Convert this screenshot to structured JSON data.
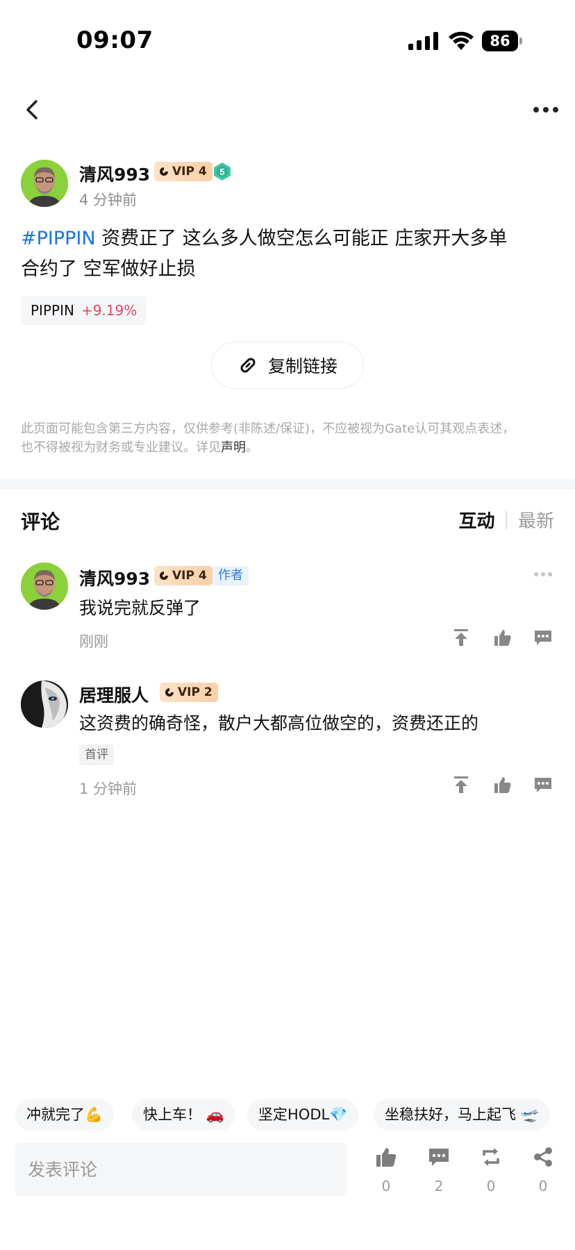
{
  "status_bar": {
    "time": "09:07",
    "battery": "86"
  },
  "post": {
    "author": "清风993",
    "vip": "VIP 4",
    "level": "5",
    "time": "4 分钟前",
    "hashtag": "#PIPPIN",
    "body_line1": " 资费正了  这么多人做空怎么可能正  庄家开大多单",
    "body_line2": "合约了  空军做好止损",
    "ticker": {
      "name": "PIPPIN",
      "change": "+9.19%"
    },
    "copy_link": "复制链接",
    "disclaimer_line1": "此页面可能包含第三方内容，仅供参考(非陈述/保证)，不应被视为Gate认可其观点表述，",
    "disclaimer_line2_prefix": "也不得被视为财务或专业建议。详见",
    "disclaimer_link": "声明",
    "disclaimer_suffix": "。"
  },
  "comments_section": {
    "title": "评论",
    "tabs": [
      "互动",
      "最新"
    ],
    "comments": [
      {
        "author": "清风993",
        "vip": "VIP 4",
        "tag": "作者",
        "text": "我说完就反弹了",
        "time": "刚刚"
      },
      {
        "author": "居理服人",
        "vip": "VIP 2",
        "tag": "首评",
        "text": "这资费的确奇怪，散户大都高位做空的，资费还正的",
        "time": "1 分钟前"
      }
    ]
  },
  "quick_replies": [
    "冲就完了💪",
    "快上车！ 🚗",
    "坚定HODL💎",
    "坐稳扶好，马上起飞 🛫"
  ],
  "bottom_bar": {
    "placeholder": "发表评论",
    "likes": "0",
    "comments": "2",
    "reposts": "0",
    "shares": "0"
  },
  "colors": {
    "accent_blue": "#1a73e8",
    "positive_red": "#e0475f",
    "vip_gold": "#f8cfa8"
  }
}
